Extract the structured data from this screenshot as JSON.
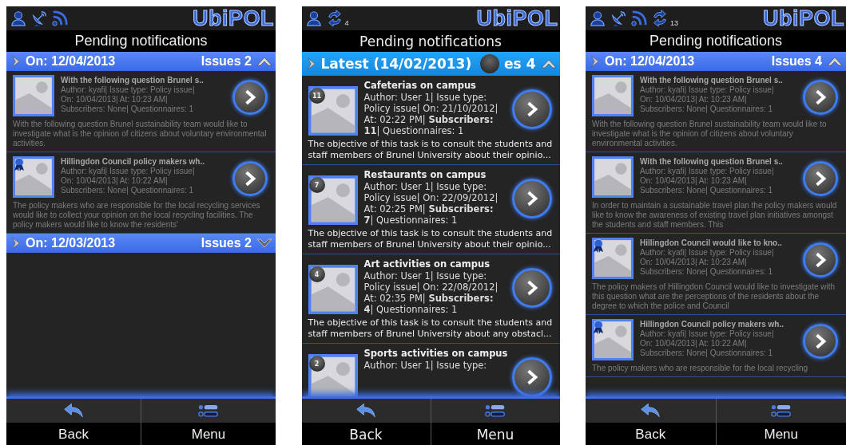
{
  "phones": [
    {
      "status_icons": [
        {
          "kind": "user"
        },
        {
          "kind": "satellite"
        },
        {
          "kind": "feed"
        }
      ],
      "logo": "UbiPOL",
      "title": "Pending notifications",
      "groups": [
        {
          "label": "On: 12/04/2013",
          "issues": "Issues 2",
          "expanded": true,
          "items": [
            {
              "title": "With the following question Brunel s..",
              "ribbon": false,
              "meta": [
                "Author: kyafi| Issue type: Policy issue|",
                "On: 10/04/2013| At: 10:23 AM|",
                "Subscribers: None| Questionnaires: 1"
              ],
              "description": "With the following question Brunel sustainability team would like to investigate what is the opinion of citizens about voluntary environmental activities."
            },
            {
              "title": "Hillingdon Council policy makers wh..",
              "ribbon": true,
              "meta": [
                "Author: kyafi| Issue type: Policy issue|",
                "On: 10/04/2013| At: 10:22 AM|",
                "Subscribers: None| Questionnaires: 1"
              ],
              "description": "The policy makers who are responsible for the local recycling services would like to collect your opinion on the local recycling facilities. The policy makers would like to know the residents'"
            }
          ]
        },
        {
          "label": "On: 12/03/2013",
          "issues": "Issues 2",
          "expanded": false
        }
      ],
      "nav": [
        {
          "kind": "back",
          "label": "Back"
        },
        {
          "kind": "menu",
          "label": "Menu"
        }
      ]
    },
    {
      "status_icons": [
        {
          "kind": "user"
        },
        {
          "kind": "sync",
          "count": "4"
        }
      ],
      "logo": "UbiPOL",
      "title": "Pending notifications",
      "groups": [
        {
          "label": "Latest (14/02/2013)",
          "issues": "es 4",
          "covered": true,
          "expanded": true,
          "items": [
            {
              "title": "Cafeterias on campus",
              "count": "11",
              "meta": [
                "Author: User 1| Issue type:",
                "Policy issue| On: 21/10/2012|",
                "At: 02:22 PM| **Subscribers:**",
                "**11**| Questionnaires: 1"
              ],
              "description": "The objective of this task is to consult the students and staff members of Brunel University about their opinio..."
            },
            {
              "title": "Restaurants on campus",
              "count": "7",
              "meta": [
                "Author: User 1| Issue type:",
                "Policy issue| On: 22/09/2012|",
                "At: 02:25 PM| **Subscribers:**",
                "**7**| Questionnaires: 1"
              ],
              "description": "The objective of this task is to consult the students and staff members of Brunel University about their opinio..."
            },
            {
              "title": "Art activities on campus",
              "count": "4",
              "meta": [
                "Author: User 1| Issue type:",
                "Policy issue| On: 22/08/2012|",
                "At: 02:35 PM| **Subscribers:**",
                "**4**| Questionnaires: 1"
              ],
              "description": "The objective of this task is to consult the students and staff members of Brunel University about any obstacl..."
            },
            {
              "title": "Sports activities on campus",
              "count": "2",
              "meta": [
                "Author: User 1| Issue type:"
              ]
            }
          ]
        }
      ],
      "nav": [
        {
          "kind": "back",
          "label": "Back"
        },
        {
          "kind": "menu",
          "label": "Menu"
        }
      ]
    },
    {
      "status_icons": [
        {
          "kind": "user"
        },
        {
          "kind": "satellite"
        },
        {
          "kind": "feed"
        },
        {
          "kind": "sync",
          "count": "13"
        }
      ],
      "logo": "UbiPOL",
      "title": "Pending notifications",
      "groups": [
        {
          "label": "On: 12/04/2013",
          "issues": "Issues 4",
          "expanded": true,
          "items": [
            {
              "title": "With the following question Brunel s..",
              "ribbon": false,
              "meta": [
                "Author: kyafi| Issue type: Policy issue|",
                "On: 10/04/2013| At: 10:23 AM|",
                "Subscribers: None| Questionnaires: 1"
              ],
              "description": "With the following question Brunel sustainability team would like to investigate what is the opinion of citizens about voluntary environmental activities."
            },
            {
              "title": "With the following question Brunel s..",
              "ribbon": false,
              "meta": [
                "Author: kyafi| Issue type: Policy issue|",
                "On: 10/04/2013| At: 10:23 AM|",
                "Subscribers: None| Questionnaires: 1"
              ],
              "description": "In order to maintain a sustainable travel plan the policy makers would like to know the awareness of existing travel plan initiatives amongst the students and staff members. This"
            },
            {
              "title": "Hillingdon Council would like to kno..",
              "ribbon": true,
              "meta": [
                "Author: kyafi| Issue type: Policy issue|",
                "On: 10/04/2013| At: 10:23 AM|",
                "Subscribers: None| Questionnaires: 1"
              ],
              "description": "The policy makers of Hillingdon Council would like to investigate with this question what are the perceptions of the residents about the degree to which the police and Council"
            },
            {
              "title": "Hillingdon Council policy makers wh..",
              "ribbon": true,
              "meta": [
                "Author: kyafi| Issue type: Policy issue|",
                "On: 10/04/2013| At: 10:22 AM|",
                "Subscribers: None| Questionnaires: 1"
              ],
              "description": "The policy makers who are responsible for the local recycling"
            }
          ]
        }
      ],
      "nav": [
        {
          "kind": "back",
          "label": "Back"
        },
        {
          "kind": "menu",
          "label": "Menu"
        }
      ]
    }
  ]
}
